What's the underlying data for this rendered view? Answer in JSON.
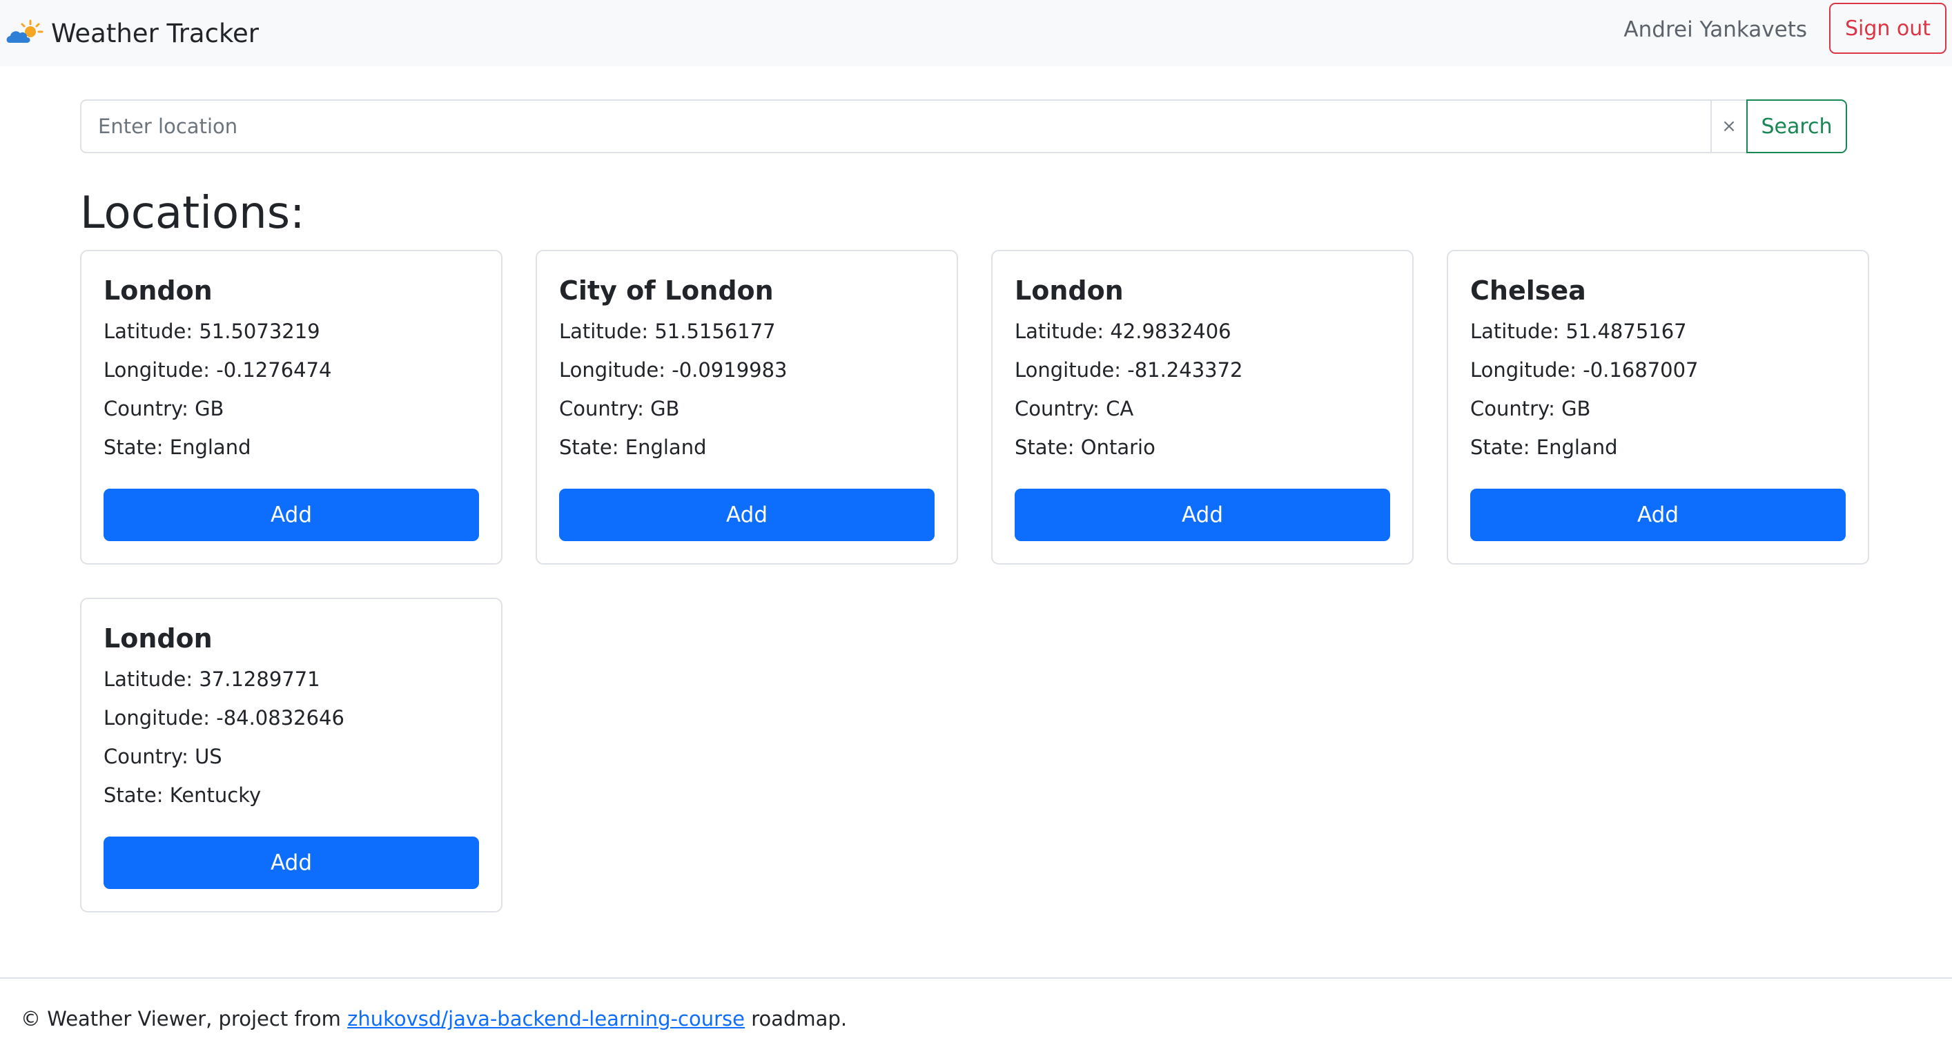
{
  "header": {
    "brand_title": "Weather Tracker",
    "brand_icon": "partly-cloudy-sun-icon",
    "user_name": "Andrei Yankavets",
    "signout_label": "Sign out"
  },
  "search": {
    "placeholder": "Enter location",
    "value": "",
    "clear_label": "×",
    "button_label": "Search"
  },
  "main": {
    "heading": "Locations:",
    "cards": [
      {
        "name": "London",
        "latitude": "Latitude: 51.5073219",
        "longitude": "Longitude: -0.1276474",
        "country": "Country: GB",
        "state": "State: England",
        "button": "Add"
      },
      {
        "name": "City of London",
        "latitude": "Latitude: 51.5156177",
        "longitude": "Longitude: -0.0919983",
        "country": "Country: GB",
        "state": "State: England",
        "button": "Add"
      },
      {
        "name": "London",
        "latitude": "Latitude: 42.9832406",
        "longitude": "Longitude: -81.243372",
        "country": "Country: CA",
        "state": "State: Ontario",
        "button": "Add"
      },
      {
        "name": "Chelsea",
        "latitude": "Latitude: 51.4875167",
        "longitude": "Longitude: -0.1687007",
        "country": "Country: GB",
        "state": "State: England",
        "button": "Add"
      },
      {
        "name": "London",
        "latitude": "Latitude: 37.1289771",
        "longitude": "Longitude: -84.0832646",
        "country": "Country: US",
        "state": "State: Kentucky",
        "button": "Add"
      }
    ]
  },
  "footer": {
    "prefix": "© Weather Viewer, project from ",
    "link_text": "zhukovsd/java-backend-learning-course",
    "suffix": " roadmap."
  },
  "colors": {
    "primary": "#0d6efd",
    "danger": "#dc3545",
    "success": "#198754",
    "navbar_bg": "#f8f9fa"
  }
}
